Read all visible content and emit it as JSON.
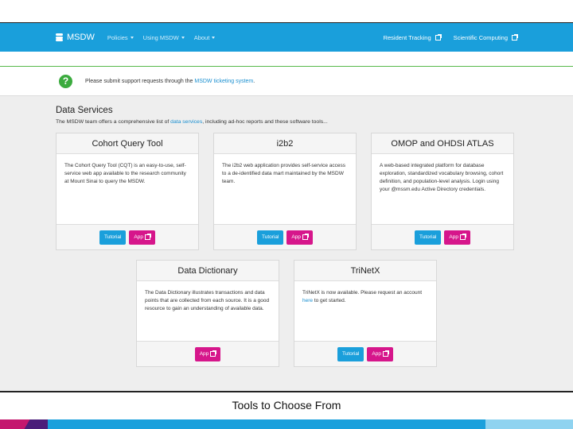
{
  "colors": {
    "navbar": "#1a9fdb",
    "accent_green": "#3bab3e",
    "btn_blue": "#1a9fdb",
    "btn_pink": "#d6168b",
    "band_pink": "#c4176e",
    "band_purple": "#4b1d7a",
    "band_blue": "#1aa0dc",
    "band_light": "#8fd3f0"
  },
  "navbar": {
    "brand": "MSDW",
    "brand_icon": "database-icon",
    "menus": [
      "Policies",
      "Using MSDW",
      "About"
    ],
    "right_links": [
      "Resident Tracking",
      "Scientific Computing"
    ]
  },
  "notice": {
    "icon": "question-icon",
    "help_glyph": "?",
    "text": "Please submit support requests through the ",
    "link": "MSDW ticketing system",
    "suffix": "."
  },
  "section": {
    "title": "Data Services",
    "desc_prefix": "The MSDW team offers a comprehensive list of ",
    "desc_link": "data services",
    "desc_suffix": ", including ad-hoc reports and these software tools..."
  },
  "cards": [
    {
      "title": "Cohort Query Tool",
      "body": "The Cohort Query Tool (CQT) is an easy-to-use, self-service web app available to the research community at Mount Sinai to query the MSDW.",
      "tutorial": "Tutorial",
      "app": "App"
    },
    {
      "title": "i2b2",
      "body": "The i2b2 web application provides self-service access to a de-identified data mart maintained by the MSDW team.",
      "tutorial": "Tutorial",
      "app": "App"
    },
    {
      "title": "OMOP and OHDSI ATLAS",
      "body": "A web-based integrated platform for database exploration, standardized vocabulary browsing, cohort definition, and population-level analysis. Login using your @mssm.edu Active Directory credentials.",
      "tutorial": "Tutorial",
      "app": "App"
    },
    {
      "title": "Data Dictionary",
      "body": "The Data Dictionary illustrates transactions and data points that are collected from each source. It is a good resource to gain an understanding of available data.",
      "app": "App"
    },
    {
      "title": "TriNetX",
      "body_prefix": "TriNetX is now available. Please request an account ",
      "body_link": "here",
      "body_suffix": " to get started.",
      "tutorial": "Tutorial",
      "app": "App"
    }
  ],
  "caption": "Tools to Choose From"
}
